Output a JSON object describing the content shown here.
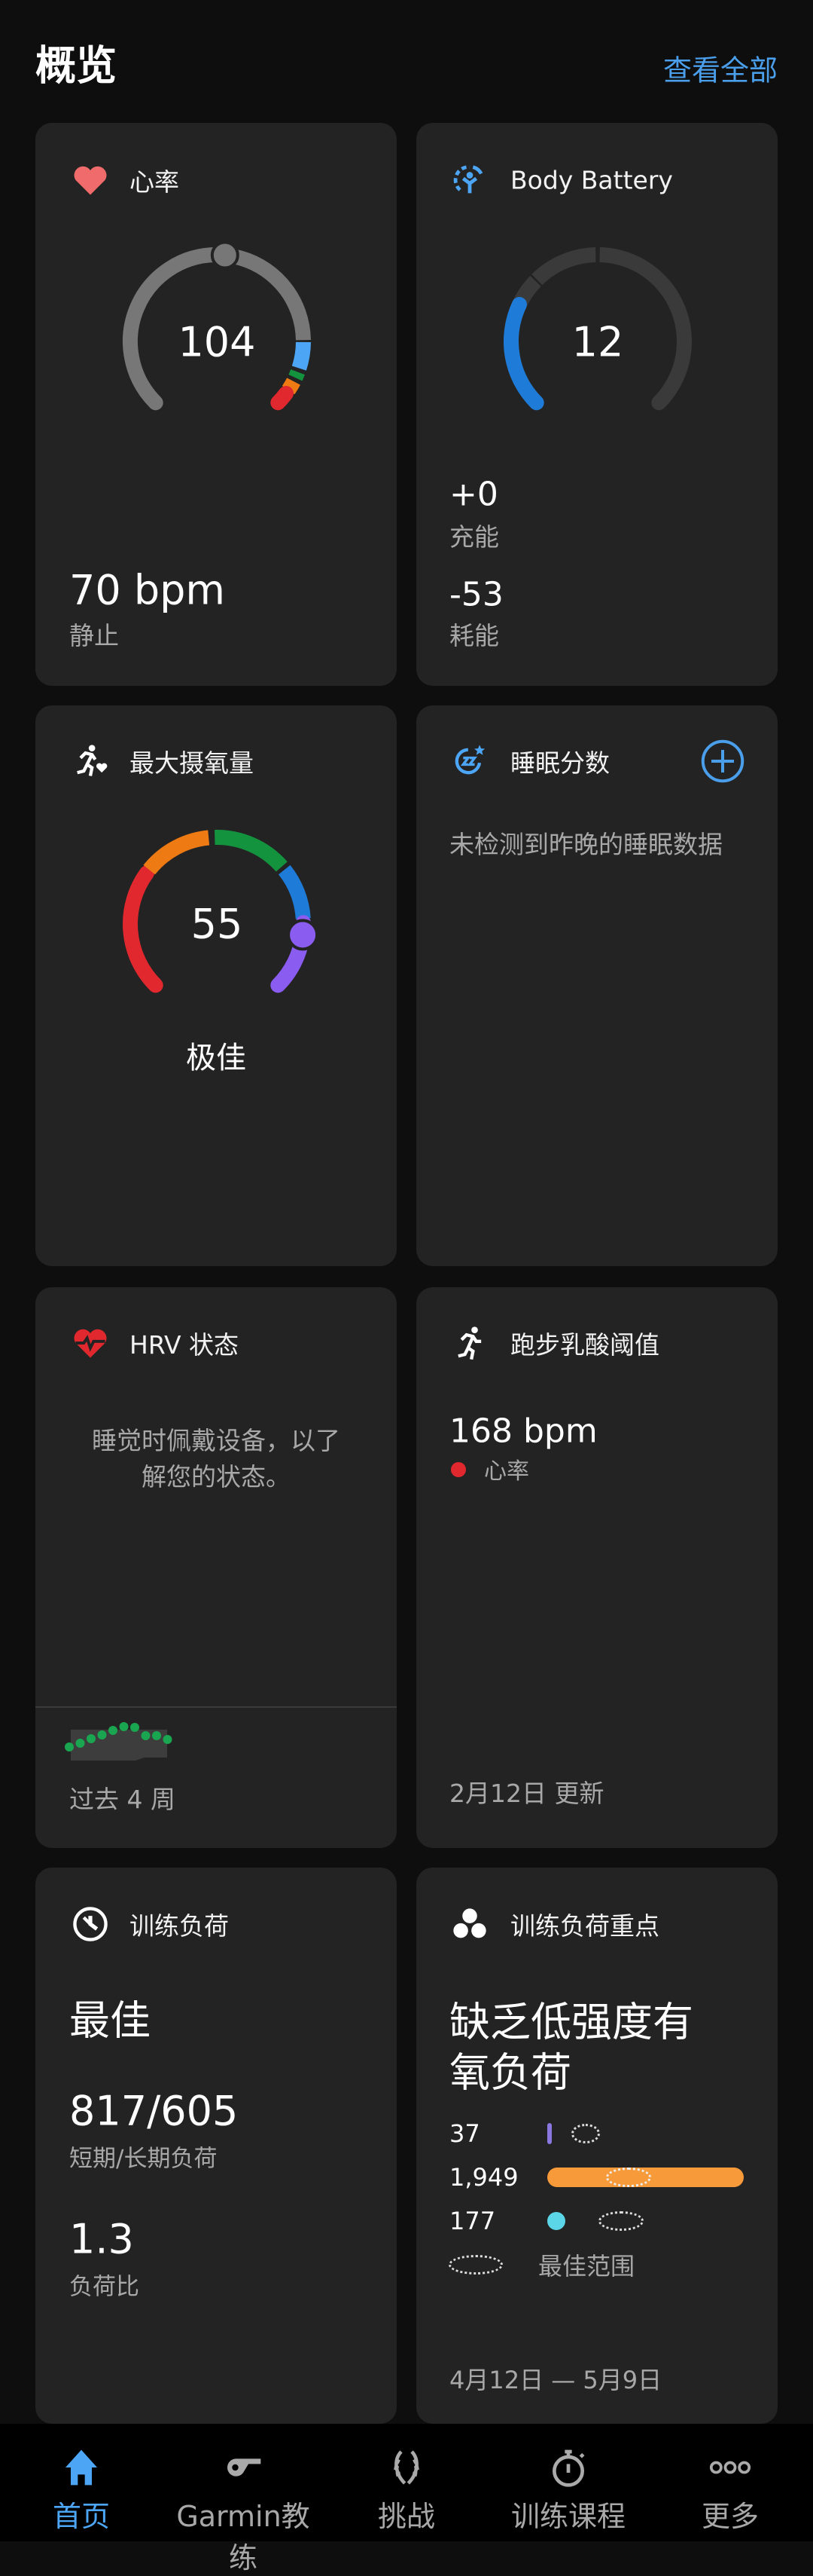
{
  "header": {
    "title": "概览",
    "view_all": "查看全部"
  },
  "colors": {
    "accent": "#4a9eea",
    "card": "#232323",
    "heart": "#f06b6b",
    "red": "#e0282e",
    "orange": "#ee7a14",
    "green": "#14933f",
    "blue": "#1e7bd8",
    "purple": "#8a5cf0",
    "lightblue": "#4da6f5",
    "cyan": "#5ad6e8",
    "amber": "#f79a3a"
  },
  "heart_rate": {
    "title": "心率",
    "current": "104",
    "resting_value": "70 bpm",
    "resting_label": "静止"
  },
  "body_battery": {
    "title": "Body Battery",
    "value": "12",
    "level_percent": 12,
    "charged_value": "+0",
    "charged_label": "充能",
    "drained_value": "-53",
    "drained_label": "耗能"
  },
  "vo2max": {
    "title": "最大摄氧量",
    "value": "55",
    "rating": "极佳"
  },
  "sleep": {
    "title": "睡眠分数",
    "message": "未检测到昨晚的睡眠数据"
  },
  "hrv": {
    "title": "HRV 状态",
    "message": "睡觉时佩戴设备，以了解您的状态。",
    "period": "过去 4 周"
  },
  "lactate": {
    "title": "跑步乳酸阈值",
    "value": "168 bpm",
    "legend": "心率",
    "updated": "2月12日 更新"
  },
  "training_load": {
    "title": "训练负荷",
    "status": "最佳",
    "loads": "817/605",
    "loads_label": "短期/长期负荷",
    "ratio": "1.3",
    "ratio_label": "负荷比"
  },
  "load_focus": {
    "title": "训练负荷重点",
    "headline_1": "缺乏低强度有",
    "headline_2": "氧负荷",
    "rows": [
      {
        "value": "37",
        "color": "#8a78e0"
      },
      {
        "value": "1,949",
        "color": "#f79a3a"
      },
      {
        "value": "177",
        "color": "#5ad6e8"
      }
    ],
    "legend": "最佳范围",
    "date_range": "4月12日 — 5月9日"
  },
  "nav": [
    {
      "label": "首页",
      "icon": "home-icon",
      "active": true
    },
    {
      "label": "Garmin教练",
      "icon": "whistle-icon"
    },
    {
      "label": "挑战",
      "icon": "laurel-icon"
    },
    {
      "label": "训练课程",
      "icon": "stopwatch-icon"
    },
    {
      "label": "更多",
      "icon": "more-icon"
    }
  ]
}
